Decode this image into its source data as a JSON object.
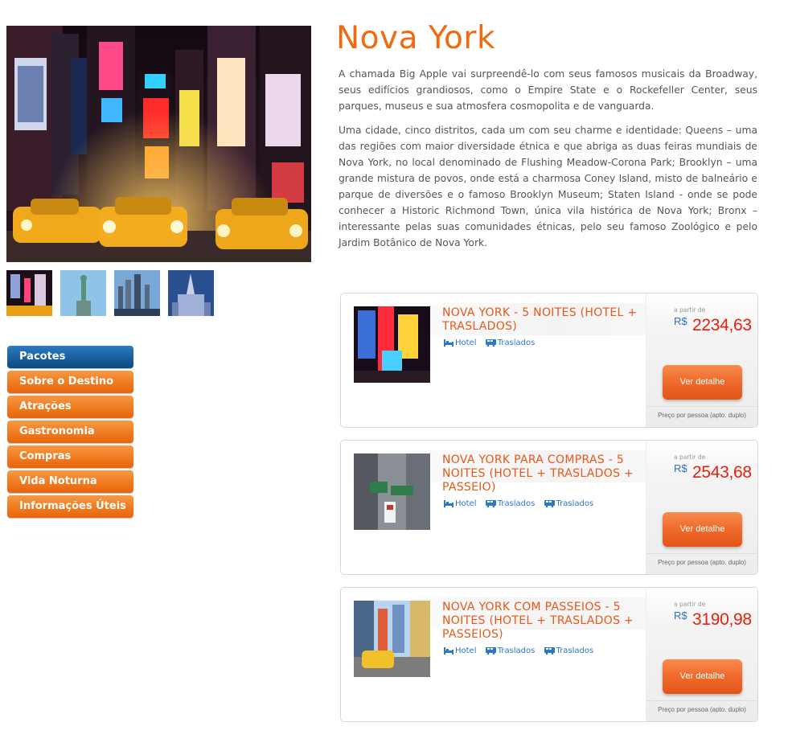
{
  "destination": {
    "title": "Nova York",
    "paragraphs": [
      "A chamada Big Apple  vai surpreendê-lo com seus famosos musicais da Broadway, seus edifícios grandiosos, como o Empire State e o Rockefeller Center, seus parques, museus e sua atmosfera cosmopolita e de vanguarda.",
      "Uma cidade, cinco distritos, cada um com seu charme e identidade: Queens – uma das regiões com maior diversidade étnica e que abriga as duas feiras mundiais de Nova York, no local denominado de Flushing Meadow-Corona Park; Brooklyn – uma grande mistura de povos, onde está a charmosa Coney Island, misto de balneário e parque de diversões e o famoso Brooklyn Museum; Staten Island - onde se pode conhecer a Historic Richmond Town, única vila histórica de Nova York; Bronx – interessante pelas suas comunidades étnicas, pelo seu famoso Zoológico e pelo Jardim Botânico de Nova York."
    ]
  },
  "menu": {
    "items": [
      {
        "label": "Pacotes",
        "active": true
      },
      {
        "label": "Sobre o Destino",
        "active": false
      },
      {
        "label": "Atrações",
        "active": false
      },
      {
        "label": "Gastronomia",
        "active": false
      },
      {
        "label": "Compras",
        "active": false
      },
      {
        "label": "Vida Noturna",
        "active": false
      },
      {
        "label": "Informações Úteis",
        "active": false
      }
    ]
  },
  "packages": [
    {
      "title": "NOVA YORK - 5 NOITES (HOTEL + TRASLADOS)",
      "tags": [
        {
          "label": "Hotel",
          "icon": "bed-icon"
        },
        {
          "label": "Traslados",
          "icon": "bus-icon"
        }
      ],
      "from_label": "a partir de",
      "currency": "R$",
      "price": "2234,63",
      "button": "Ver detalhe",
      "note": "Preço por pessoa (apto. duplo)"
    },
    {
      "title": "NOVA YORK PARA COMPRAS - 5 NOITES (HOTEL + TRASLADOS + PASSEIO)",
      "tags": [
        {
          "label": "Hotel",
          "icon": "bed-icon"
        },
        {
          "label": "Traslados",
          "icon": "bus-icon"
        },
        {
          "label": "Traslados",
          "icon": "bus-icon"
        }
      ],
      "from_label": "a partir de",
      "currency": "R$",
      "price": "2543,68",
      "button": "Ver detalhe",
      "note": "Preço por pessoa (apto. duplo)"
    },
    {
      "title": "NOVA YORK COM PASSEIOS - 5 NOITES (HOTEL + TRASLADOS + PASSEIOS)",
      "tags": [
        {
          "label": "Hotel",
          "icon": "bed-icon"
        },
        {
          "label": "Traslados",
          "icon": "bus-icon"
        },
        {
          "label": "Traslados",
          "icon": "bus-icon"
        }
      ],
      "from_label": "a partir de",
      "currency": "R$",
      "price": "3190,98",
      "button": "Ver detalhe",
      "note": "Preço por pessoa (apto. duplo)"
    }
  ],
  "colors": {
    "accent_orange": "#f06a12",
    "price_red": "#e3220e",
    "link_blue": "#2b78c4",
    "menu_active_blue": "#1a5e9d"
  }
}
